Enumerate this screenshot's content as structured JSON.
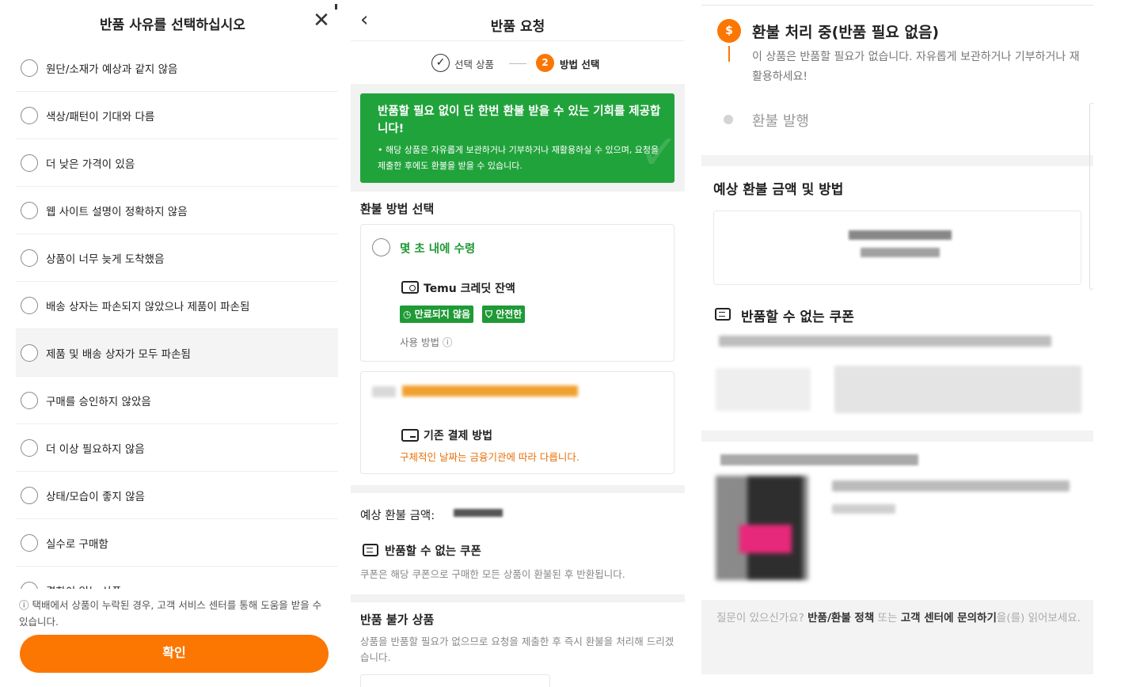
{
  "reason_panel": {
    "title": "반품 사유를 선택하십시오",
    "close_glyph": "✕",
    "reasons": [
      "원단/소재가 예상과 같지 않음",
      "색상/패턴이 기대와 다름",
      "더 낮은 가격이 있음",
      "웹 사이트 설명이 정확하지 않음",
      "상품이 너무 늦게 도착했음",
      "배송 상자는 파손되지 않았으나 제품이 파손됨",
      "제품 및 배송 상자가 모두 파손됨",
      "구매를 승인하지 않았음",
      "더 이상 필요하지 않음",
      "상태/모습이 좋지 않음",
      "실수로 구매함",
      "결함이 있는 상품"
    ],
    "highlighted_index": 6,
    "footer_note": "ⓘ 택배에서 상품이 누락된 경우, 고객 서비스 센터를 통해 도움을 받을 수 있습니다.",
    "confirm_label": "확인",
    "accent_color": "#fb7701"
  },
  "request_panel": {
    "back_glyph": "‹",
    "title": "반품 요청",
    "step1_label": "선택 상품",
    "step2_number": "2",
    "step2_label": "방법 선택",
    "banner_title": "반품할 필요 없이 단 한번 환불 받을 수 있는 기회를 제공합니다!",
    "banner_bullet": "• 해당 상품은 자유롭게 보관하거나 기부하거나 재활용하실 수 있으며, 요청을 제출한 후에도 환불을 받을 수 있습니다.",
    "banner_color": "#21a33c",
    "refund_method_title": "환불 방법 선택",
    "option1_label": "몇 초 내에 수령",
    "credit_title": "Temu 크레딧 잔액",
    "badge_not_expire": "만료되지 않음",
    "badge_safe": "안전한",
    "howto_label": "사용 방법 ⓘ",
    "original_payment_title": "기존 결제 방법",
    "original_payment_note": "구체적인 날짜는 금융기관에 따라 다릅니다.",
    "expected_amount_label": "예상 환불 금액:",
    "nonreturn_coupon_title": "반품할 수 없는 쿠폰",
    "coupon_note": "쿠폰은 해당 쿠폰으로 구매한 모든 상품이 환불된 후 반환됩니다.",
    "nonreturn_items_title": "반품 불가 상품",
    "nonreturn_items_note": "상품을 반품할 필요가 없으므로 요청을 제출한 후 즉시 환불을 처리해 드리겠습니다."
  },
  "status_panel": {
    "processing_icon": "$",
    "processing_title": "환불 처리 중(반품 필요 없음)",
    "processing_desc": "이 상품은 반품할 필요가 없습니다. 자유롭게 보관하거나 기부하거나 재활용하세요!",
    "issued_label": "환불 발행",
    "expected_title": "예상 환불 금액 및 방법",
    "nonreturn_coupon_title": "반품할 수 없는 쿠폰",
    "footer_prefix": "질문이 있으신가요? ",
    "footer_policy": "반품/환불 정책",
    "footer_or": " 또는 ",
    "footer_contact": "고객 센터에 문의하기",
    "footer_suffix": "을(를) 읽어보세요."
  }
}
